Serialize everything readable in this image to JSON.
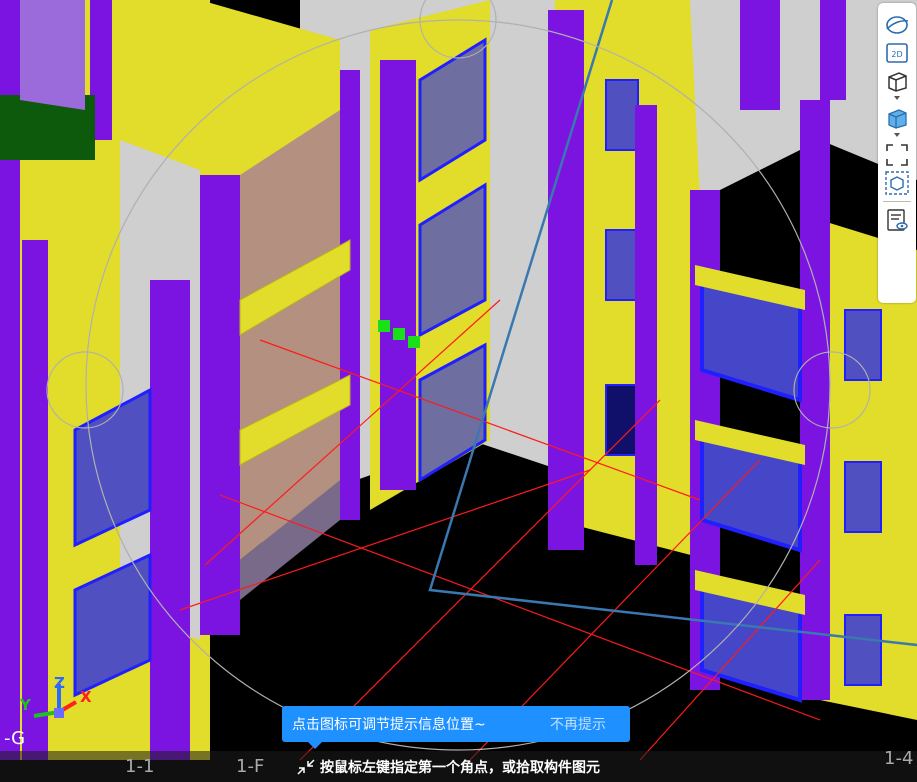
{
  "tooltip": {
    "message": "点击图标可调节提示信息位置~",
    "dismiss_label": "不再提示"
  },
  "status": {
    "prompt": "按鼠标左键指定第一个角点，或拾取构件图元"
  },
  "axis_labels": {
    "left": "1-1",
    "middle": "1-F",
    "right": "1-4",
    "side": "-G"
  },
  "axis_gizmo": {
    "x": "X",
    "y": "Y",
    "z": "Z"
  },
  "toolbar": {
    "view2d_label": "2D"
  },
  "colors": {
    "wall_yellow": "#e2dc2a",
    "column_purple": "#7b14e0",
    "window_blue": "#3a3ad0",
    "grid_red": "#ff1a1a",
    "tip_blue": "#1e90ff"
  }
}
